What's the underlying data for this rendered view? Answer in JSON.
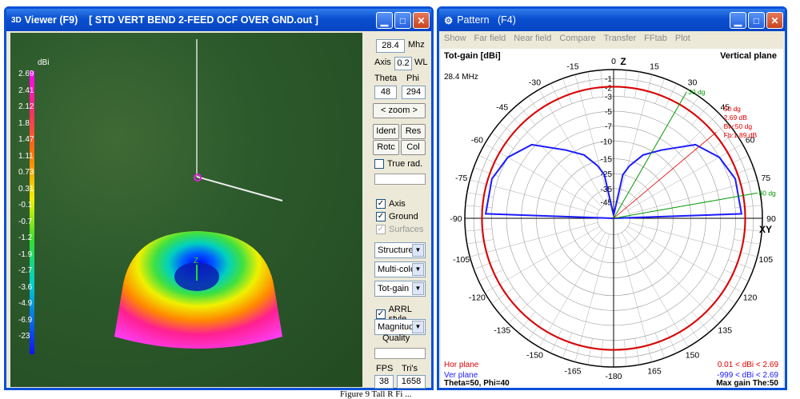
{
  "viewer": {
    "title_icon": "3D",
    "title": "Viewer (F9)    [ STD VERT BEND 2-FEED OCF OVER GND.out ]",
    "scale_unit": "dBi",
    "scale_values": [
      "2.69",
      "2.41",
      "2.12",
      "1.8",
      "1.47",
      "1.11",
      "0.73",
      "0.31",
      "-0.1",
      "-0.7",
      "-1.2",
      "-1.9",
      "-2.7",
      "-3.6",
      "-4.9",
      "-6.9",
      "-23"
    ],
    "freq": "28.4",
    "freq_unit": "Mhz",
    "axis_label": "Axis",
    "axis_value": "0.2",
    "axis_unit": "WL",
    "theta_label": "Theta",
    "phi_label": "Phi",
    "theta": "48",
    "phi": "294",
    "zoom": "zoom",
    "zoom_left": "<",
    "zoom_right": ">",
    "btn_ident": "Ident",
    "btn_res": "Res",
    "btn_rotc": "Rotc",
    "btn_col": "Col",
    "true_rad": "True rad.",
    "chk_axis": "Axis",
    "chk_ground": "Ground",
    "chk_surfaces": "Surfaces",
    "dd_structure": "Structure",
    "dd_multicolor": "Multi-colo",
    "dd_totgain": "Tot-gain",
    "arrl": "ARRL style",
    "dd_magnitude": "Magnituc",
    "quality": "Quality",
    "fps_label": "FPS",
    "tris_label": "Tri's",
    "fps": "38",
    "tris": "1658",
    "axis_z": "Z"
  },
  "pattern": {
    "title": "Pattern   (F4)",
    "menu": [
      "Show",
      "Far field",
      "Near field",
      "Compare",
      "Transfer",
      "FFtab",
      "Plot"
    ],
    "gain_label": "Tot-gain [dBi]",
    "plane": "Vertical plane",
    "freq": "28.4 MHz",
    "axis_z": "Z",
    "axis_xy": "XY",
    "angle_labels": {
      "a0": "0",
      "a15": "15",
      "a30": "30",
      "a45": "45",
      "a60": "60",
      "a75": "75",
      "a90": "90",
      "am15": "-15",
      "am30": "-30",
      "am45": "-45",
      "am60": "-60",
      "am75": "-75",
      "am90": "-90",
      "am105": "-105",
      "am120": "-120",
      "am135": "-135",
      "am150": "-150",
      "am165": "-165",
      "am180": "-180",
      "b165": "165",
      "b150": "150",
      "b135": "135",
      "b120": "120",
      "b105": "105"
    },
    "ring_labels": [
      "-1",
      "-2",
      "-3",
      "-5",
      "-7",
      "-10",
      "-15",
      "-25",
      "-35",
      "-45"
    ],
    "cursor_30": "30 dg",
    "cursor_80": "80 dg",
    "marker": {
      "dg": "50 dg",
      "db": "2.69 dB",
      "bw": "Bw:50 dg",
      "fb": "Fb:1.89 dB"
    },
    "hor_plane": "Hor plane",
    "ver_plane": "Ver plane",
    "hor_range": "0.01 < dBi < 2.69",
    "ver_range": "-999 < dBi < 2.69",
    "theta_phi": "Theta=50, Phi=40",
    "max_gain": "Max gain The:50",
    "colors": {
      "hor": "#e00000",
      "ver": "#1a1aff",
      "cursor": "#009900"
    }
  },
  "caption": "Figure 9 Tall R Fi ..."
}
